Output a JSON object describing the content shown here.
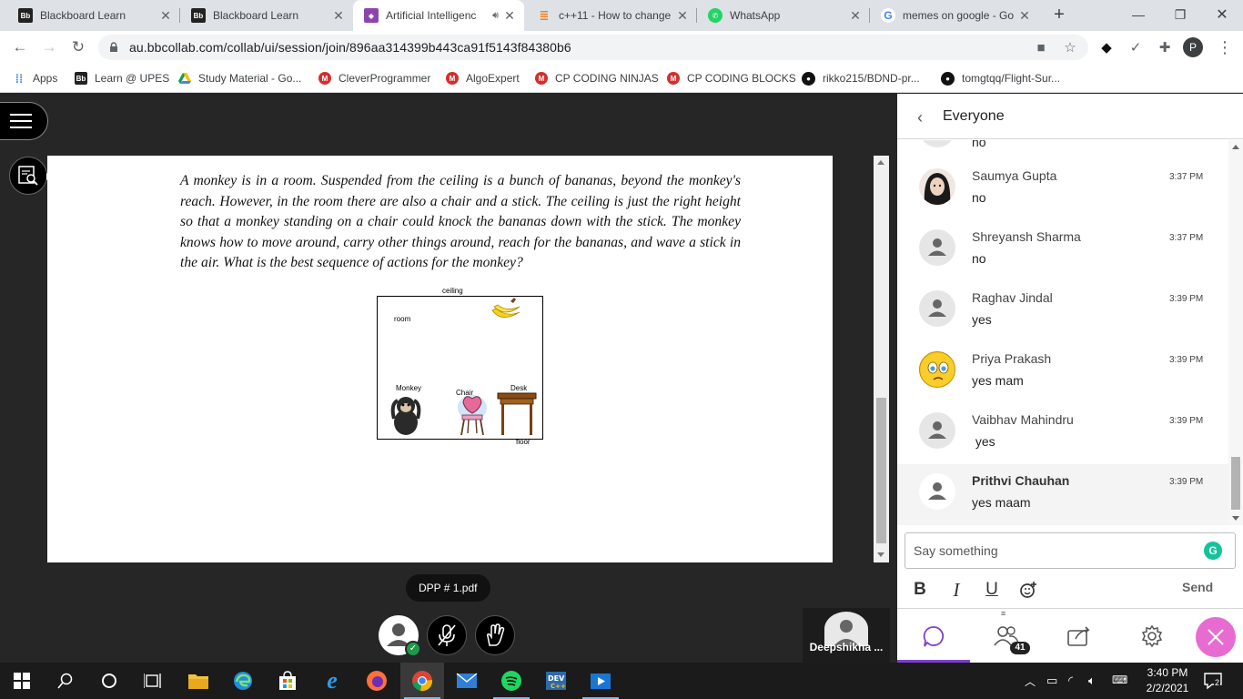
{
  "browser": {
    "tabs": [
      {
        "title": "Blackboard Learn",
        "favicon": "blackboard-icon",
        "active": false
      },
      {
        "title": "Blackboard Learn",
        "favicon": "blackboard-icon",
        "active": false
      },
      {
        "title": "Artificial Intelligenc",
        "favicon": "collab-icon",
        "active": true,
        "audio": true
      },
      {
        "title": "c++11 - How to change",
        "favicon": "stackoverflow-icon",
        "active": false
      },
      {
        "title": "WhatsApp",
        "favicon": "whatsapp-icon",
        "active": false
      },
      {
        "title": "memes on google - Go",
        "favicon": "google-icon",
        "active": false
      }
    ],
    "url": "au.bbcollab.com/collab/ui/session/join/896aa314399b443ca91f5143f84380b6",
    "profile_initial": "P",
    "bookmarks": [
      {
        "label": "Apps",
        "icon": "apps-grid-icon"
      },
      {
        "label": "Learn @ UPES",
        "icon": "blackboard-icon"
      },
      {
        "label": "Study Material - Go...",
        "icon": "google-drive-icon"
      },
      {
        "label": "CleverProgrammer",
        "icon": "m-icon"
      },
      {
        "label": "AlgoExpert",
        "icon": "m-icon"
      },
      {
        "label": "CP CODING NINJAS",
        "icon": "m-icon"
      },
      {
        "label": "CP CODING BLOCKS",
        "icon": "m-icon"
      },
      {
        "label": "rikko215/BDND-pr...",
        "icon": "github-icon"
      },
      {
        "label": "tomgtqq/Flight-Sur...",
        "icon": "github-icon"
      }
    ]
  },
  "document": {
    "paragraph": "A monkey is in a room. Suspended from the ceiling is a bunch of bananas, beyond the monkey's reach. However, in the room there are also a chair and a stick. The ceiling is just the right height so that a monkey standing on a chair could knock the bananas down with the stick. The monkey knows how to move around, carry other things around, reach for the bananas, and wave a stick in the air. What is the best sequence of actions for the monkey?",
    "figure_labels": {
      "ceiling": "ceiling",
      "room": "room",
      "monkey": "Monkey",
      "chair": "Chair",
      "desk": "Desk",
      "floor": "floor"
    },
    "filename": "DPP # 1.pdf"
  },
  "participant_tile": {
    "name": "Deepshikha ..."
  },
  "chat": {
    "header": "Everyone",
    "partial_top_text": "no",
    "messages": [
      {
        "name": "Saumya Gupta",
        "time": "3:37 PM",
        "text": "no",
        "avatar": "photo"
      },
      {
        "name": "Shreyansh Sharma",
        "time": "3:37 PM",
        "text": "no",
        "avatar": "default"
      },
      {
        "name": "Raghav Jindal",
        "time": "3:39 PM",
        "text": "yes",
        "avatar": "default"
      },
      {
        "name": "Priya Prakash",
        "time": "3:39 PM",
        "text": "yes mam",
        "avatar": "emoji"
      },
      {
        "name": "Vaibhav Mahindru",
        "time": "3:39 PM",
        "text": " yes",
        "avatar": "default"
      },
      {
        "name": "Prithvi Chauhan",
        "time": "3:39 PM",
        "text": "yes maam",
        "avatar": "default",
        "highlight": true
      }
    ],
    "placeholder": "Say something",
    "send_label": "Send",
    "grammarly_letter": "G",
    "attendee_count": "41"
  },
  "taskbar": {
    "time": "3:40 PM",
    "date": "2/2/2021",
    "notification_count": "2"
  }
}
